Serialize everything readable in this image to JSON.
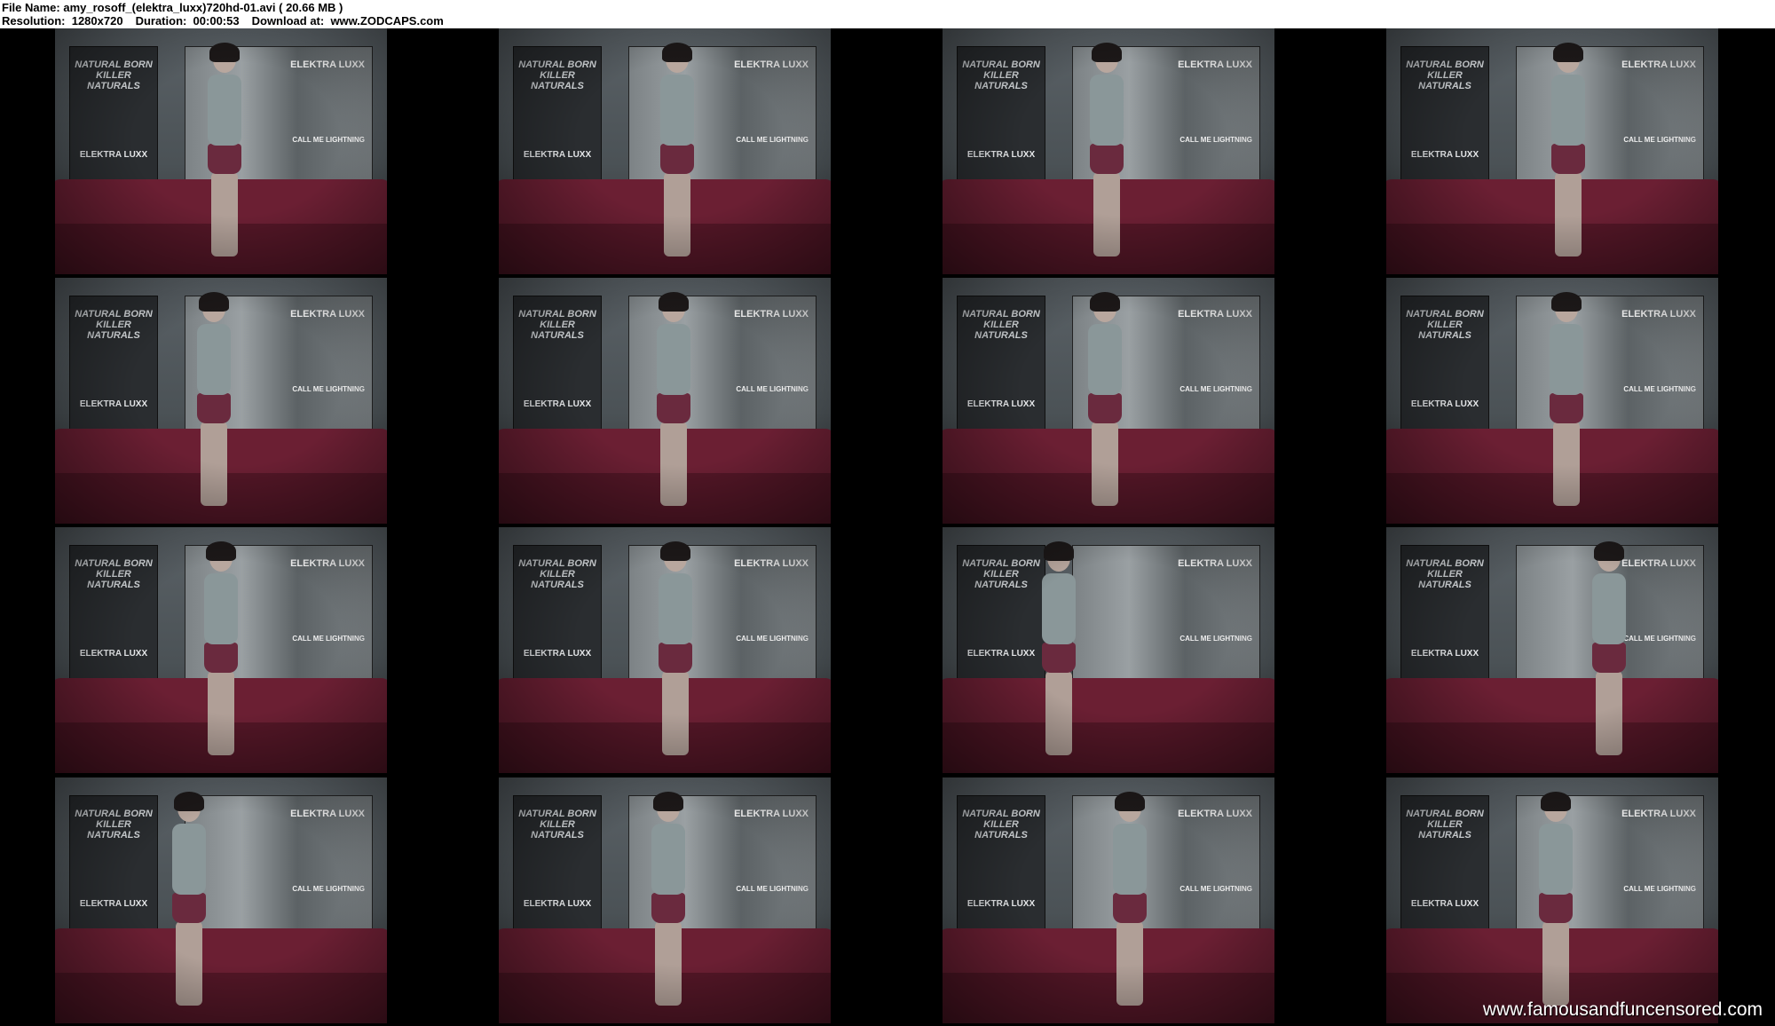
{
  "header": {
    "line1": "File Name: amy_rosoff_(elektra_luxx)720hd-01.avi ( 20.66 MB )",
    "resolution": "Resolution:  1280x720",
    "duration": "Duration:  00:00:53",
    "download": "Download at:  www.ZODCAPS.com"
  },
  "frame_labels": {
    "poster_left_title": "NATURAL BORN\nKILLER NATURALS",
    "poster_left_brand": "ELEKTRA LUXX",
    "poster_right_title": "ELEKTRA LUXX",
    "poster_right_tagline": "CALL ME LIGHTNING"
  },
  "colors": {
    "sheet_background": "#000000",
    "header_background": "#ffffff",
    "sofa": "#6b1f33"
  },
  "frame_count": 16,
  "watermark": "www.famousandfuncensored.com"
}
